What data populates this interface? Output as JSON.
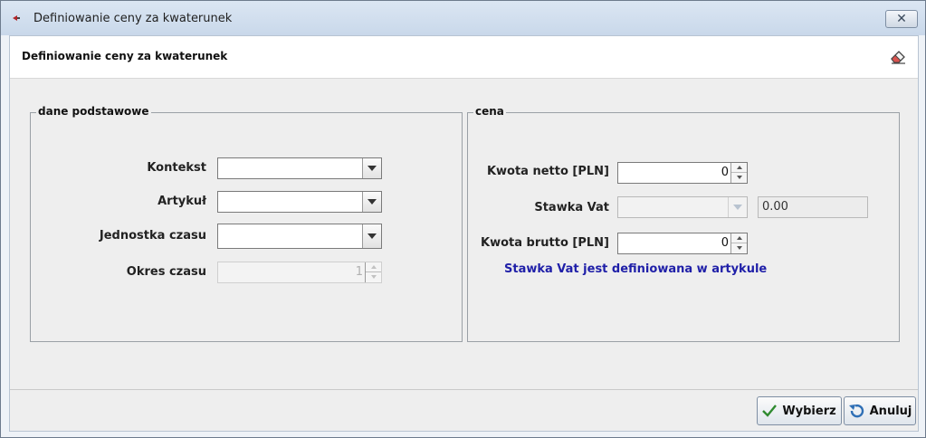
{
  "window": {
    "title": "Definiowanie ceny za kwaterunek"
  },
  "header": {
    "title": "Definiowanie ceny za kwaterunek"
  },
  "basic_group": {
    "title": "dane podstawowe",
    "fields": [
      {
        "label": "Kontekst",
        "value": ""
      },
      {
        "label": "Artykuł",
        "value": ""
      },
      {
        "label": "Jednostka czasu",
        "value": ""
      },
      {
        "label": "Okres czasu",
        "value": "1"
      }
    ]
  },
  "price_group": {
    "title": "cena",
    "net_label": "Kwota netto [PLN]",
    "net_value": "0",
    "vat_label": "Stawka Vat",
    "vat_rate_value": "0.00",
    "gross_label": "Kwota brutto [PLN]",
    "gross_value": "0",
    "info_text": "Stawka Vat jest definiowana w artykule"
  },
  "buttons": {
    "select": "Wybierz",
    "cancel": "Anuluj"
  },
  "colors": {
    "info": "#1f1fa8",
    "titlebar": "#d4e0ef"
  }
}
